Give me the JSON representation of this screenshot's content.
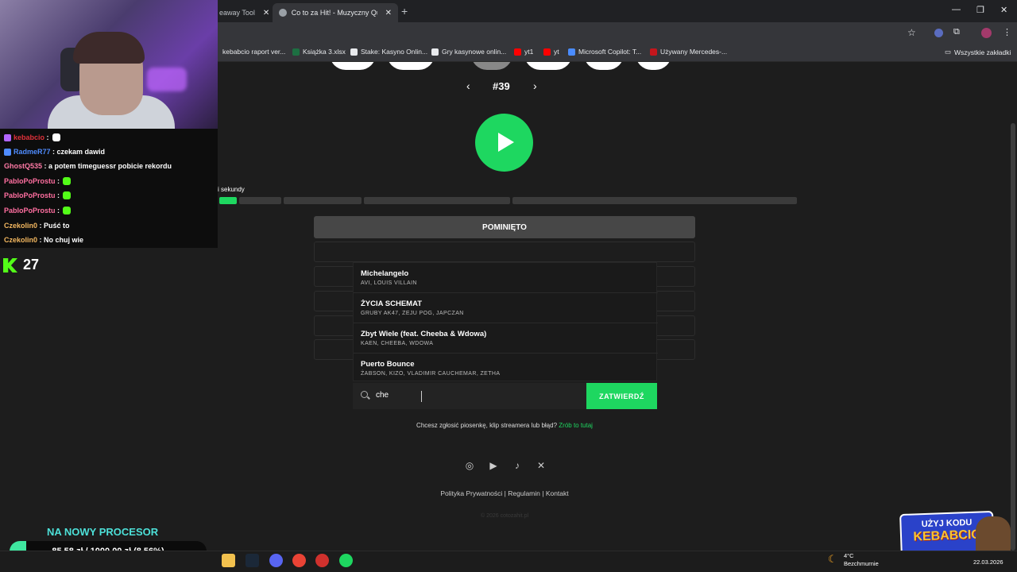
{
  "browser": {
    "tabs": [
      {
        "label": "eaway Tool",
        "active": false
      },
      {
        "label": "Co to za Hit! - Muzyczny Quiz",
        "active": true
      }
    ],
    "bookmarks": [
      {
        "label": "kebabcio raport ver...",
        "color": "#ffffff"
      },
      {
        "label": "Książka 3.xlsx",
        "color": "#1d6f42"
      },
      {
        "label": "Stake: Kasyno Onlin...",
        "color": "#e8eaed"
      },
      {
        "label": "Gry kasynowe onlin...",
        "color": "#e8eaed"
      },
      {
        "label": "yt1",
        "color": "#ff0000"
      },
      {
        "label": "yt",
        "color": "#ff0000"
      },
      {
        "label": "Microsoft Copilot: T...",
        "color": "#4a8cff"
      },
      {
        "label": "Używany Mercedes-...",
        "color": "#c4161c"
      }
    ],
    "all_bookmarks": "Wszystkie zakładki"
  },
  "quiz": {
    "song_number": "#39",
    "seconds_label": "i sekundy",
    "skipped_label": "POMINIĘTO",
    "suggestions": [
      {
        "title": "Michelangelo",
        "artists": "AVI, LOUIS VILLAIN"
      },
      {
        "title": "ŻYCIA SCHEMAT",
        "artists": "GRUBY AK47, ZEJU POG, JAPCZAN"
      },
      {
        "title": "Zbyt Wiele (feat. Cheeba & Wdowa)",
        "artists": "KAEN, CHEEBA, WDOWA"
      },
      {
        "title": "Puerto Bounce",
        "artists": "ŻABSON, KIZO, VLADIMIR CAUCHEMAR, ZETHA"
      }
    ],
    "search_value": "che",
    "confirm_label": "ZATWIERDŹ",
    "report_text": "Chcesz zgłosić piosenkę, klip streamera lub błąd?",
    "report_link": "Zrób to tutaj",
    "footer_links": [
      "Polityka Prywatności",
      "Regulamin",
      "Kontakt"
    ],
    "copyright": "© 2026 cotozahit.pl",
    "accent_color": "#1ed760"
  },
  "stream": {
    "chat": [
      {
        "user": "kebabcio",
        "user_color": "#e0313a",
        "message": "",
        "emote": true,
        "emote_color": "#ffffff",
        "badge_color": "#b266ff"
      },
      {
        "user": "RadmeR77",
        "user_color": "#4f8cff",
        "message": "czekam dawid",
        "emote": false,
        "badge_color": "#4f8cff"
      },
      {
        "user": "GhostQ535",
        "user_color": "#ff7aa6",
        "message": "a potem timeguessr pobicie rekordu",
        "emote": false,
        "badge_color": ""
      },
      {
        "user": "PabloPoProstu",
        "user_color": "#ff6fa0",
        "message": "",
        "emote": true,
        "emote_color": "#53fc18",
        "badge_color": ""
      },
      {
        "user": "PabloPoProstu",
        "user_color": "#ff6fa0",
        "message": "",
        "emote": true,
        "emote_color": "#53fc18",
        "badge_color": ""
      },
      {
        "user": "PabloPoProstu",
        "user_color": "#ff6fa0",
        "message": "",
        "emote": true,
        "emote_color": "#53fc18",
        "badge_color": ""
      },
      {
        "user": "Czekolin0",
        "user_color": "#f4b860",
        "message": "Puść to",
        "emote": false,
        "badge_color": ""
      },
      {
        "user": "Czekolin0",
        "user_color": "#f4b860",
        "message": "No chuj wie",
        "emote": false,
        "badge_color": ""
      }
    ],
    "viewer_count": "27",
    "goal_title": "NA NOWY PROCESOR",
    "goal_text": "85,58 zł / 1000,00 zł (8.56%)",
    "goal_progress_percent": 8.56,
    "promo_line1": "UŻYJ KODU",
    "promo_line2": "KEBABCIO"
  },
  "taskbar": {
    "weather_temp": "4°C",
    "weather_desc": "Bezchmurnie",
    "date": "22.03.2026"
  }
}
